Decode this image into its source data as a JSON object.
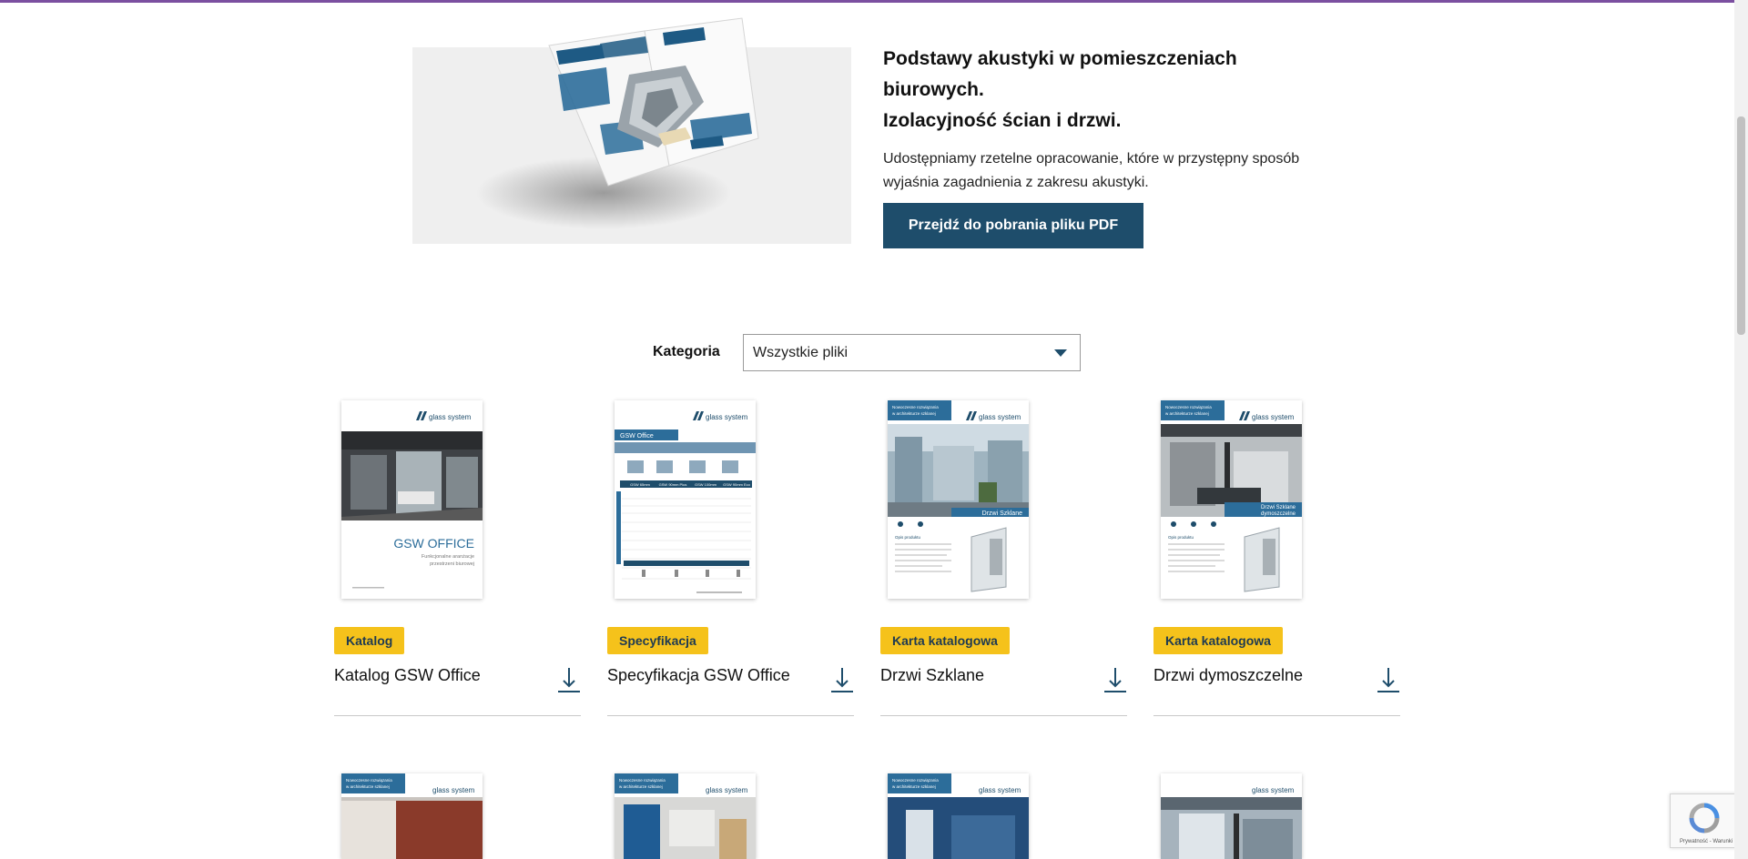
{
  "promo": {
    "title_line1": "Podstawy akustyki w pomieszczeniach biurowych.",
    "title_line2": "Izolacyjność ścian i drzwi.",
    "desc_line1": "Udostępniamy rzetelne opracowanie, które w przystępny sposób",
    "desc_line2": "wyjaśnia zagadnienia z zakresu akustyki.",
    "button_label": "Przejdź do pobrania pliku PDF"
  },
  "filter": {
    "label": "Kategoria",
    "selected": "Wszystkie pliki"
  },
  "thumb_text": {
    "brand": "glass system",
    "gsw_office": "GSW OFFICE",
    "gsw_office_sub1": "Funkcjonalne aranżacje",
    "gsw_office_sub2": "przestrzeni biurowej",
    "spec_header": "GSW Office",
    "cols": [
      "GSW 65mm",
      "GSW 90mm Plus",
      "GSW 100mm",
      "GSW 90mm Eco"
    ],
    "drzwi_szklane": "Drzwi Szklane",
    "drzwi_szklane_2": "Drzwi Szklane",
    "dymoszczelne": "dymoszczelne",
    "nowoczesne_l1": "Nowoczesne rozwiązania",
    "nowoczesne_l2": "w architekturze szklanej",
    "opis": "Opis produktu"
  },
  "cards": [
    {
      "badge": "Katalog",
      "title": "Katalog GSW Office"
    },
    {
      "badge": "Specyfikacja",
      "title": "Specyfikacja GSW Office"
    },
    {
      "badge": "Karta katalogowa",
      "title": "Drzwi Szklane"
    },
    {
      "badge": "Karta katalogowa",
      "title": "Drzwi dymoszczelne"
    }
  ],
  "recaptcha": {
    "footer": "Prywatność - Warunki"
  },
  "colors": {
    "accent": "#1e4d6b",
    "badge": "#f5c21b",
    "top_bar": "#7b4fa0"
  }
}
